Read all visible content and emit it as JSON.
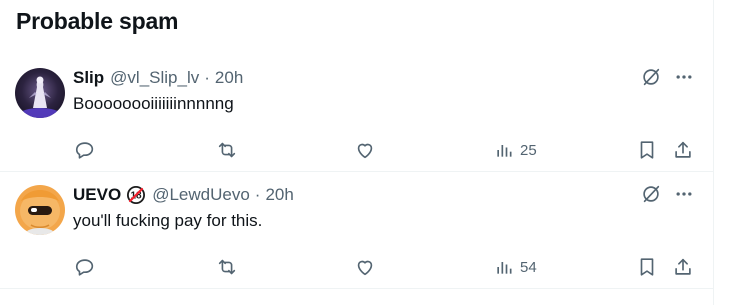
{
  "section": {
    "title": "Probable spam"
  },
  "tweets": [
    {
      "display_name": "Slip",
      "handle": "@vl_Slip_lv",
      "separator": "·",
      "time": "20h",
      "text": "Boooooooiiiiiiinnnnng",
      "has_badge": false,
      "views": "25",
      "avatar_icon": "avatar-figure-purple"
    },
    {
      "display_name": "UEVO",
      "handle": "@LewdUevo",
      "separator": "·",
      "time": "20h",
      "text": "you'll fucking pay for this.",
      "has_badge": true,
      "badge_icon": "18-plus-icon",
      "views": "54",
      "avatar_icon": "avatar-orange-character"
    }
  ],
  "colors": {
    "text_primary": "#0f1419",
    "text_secondary": "#536471",
    "divider": "#eff3f4",
    "badge_red": "#f4212e"
  }
}
